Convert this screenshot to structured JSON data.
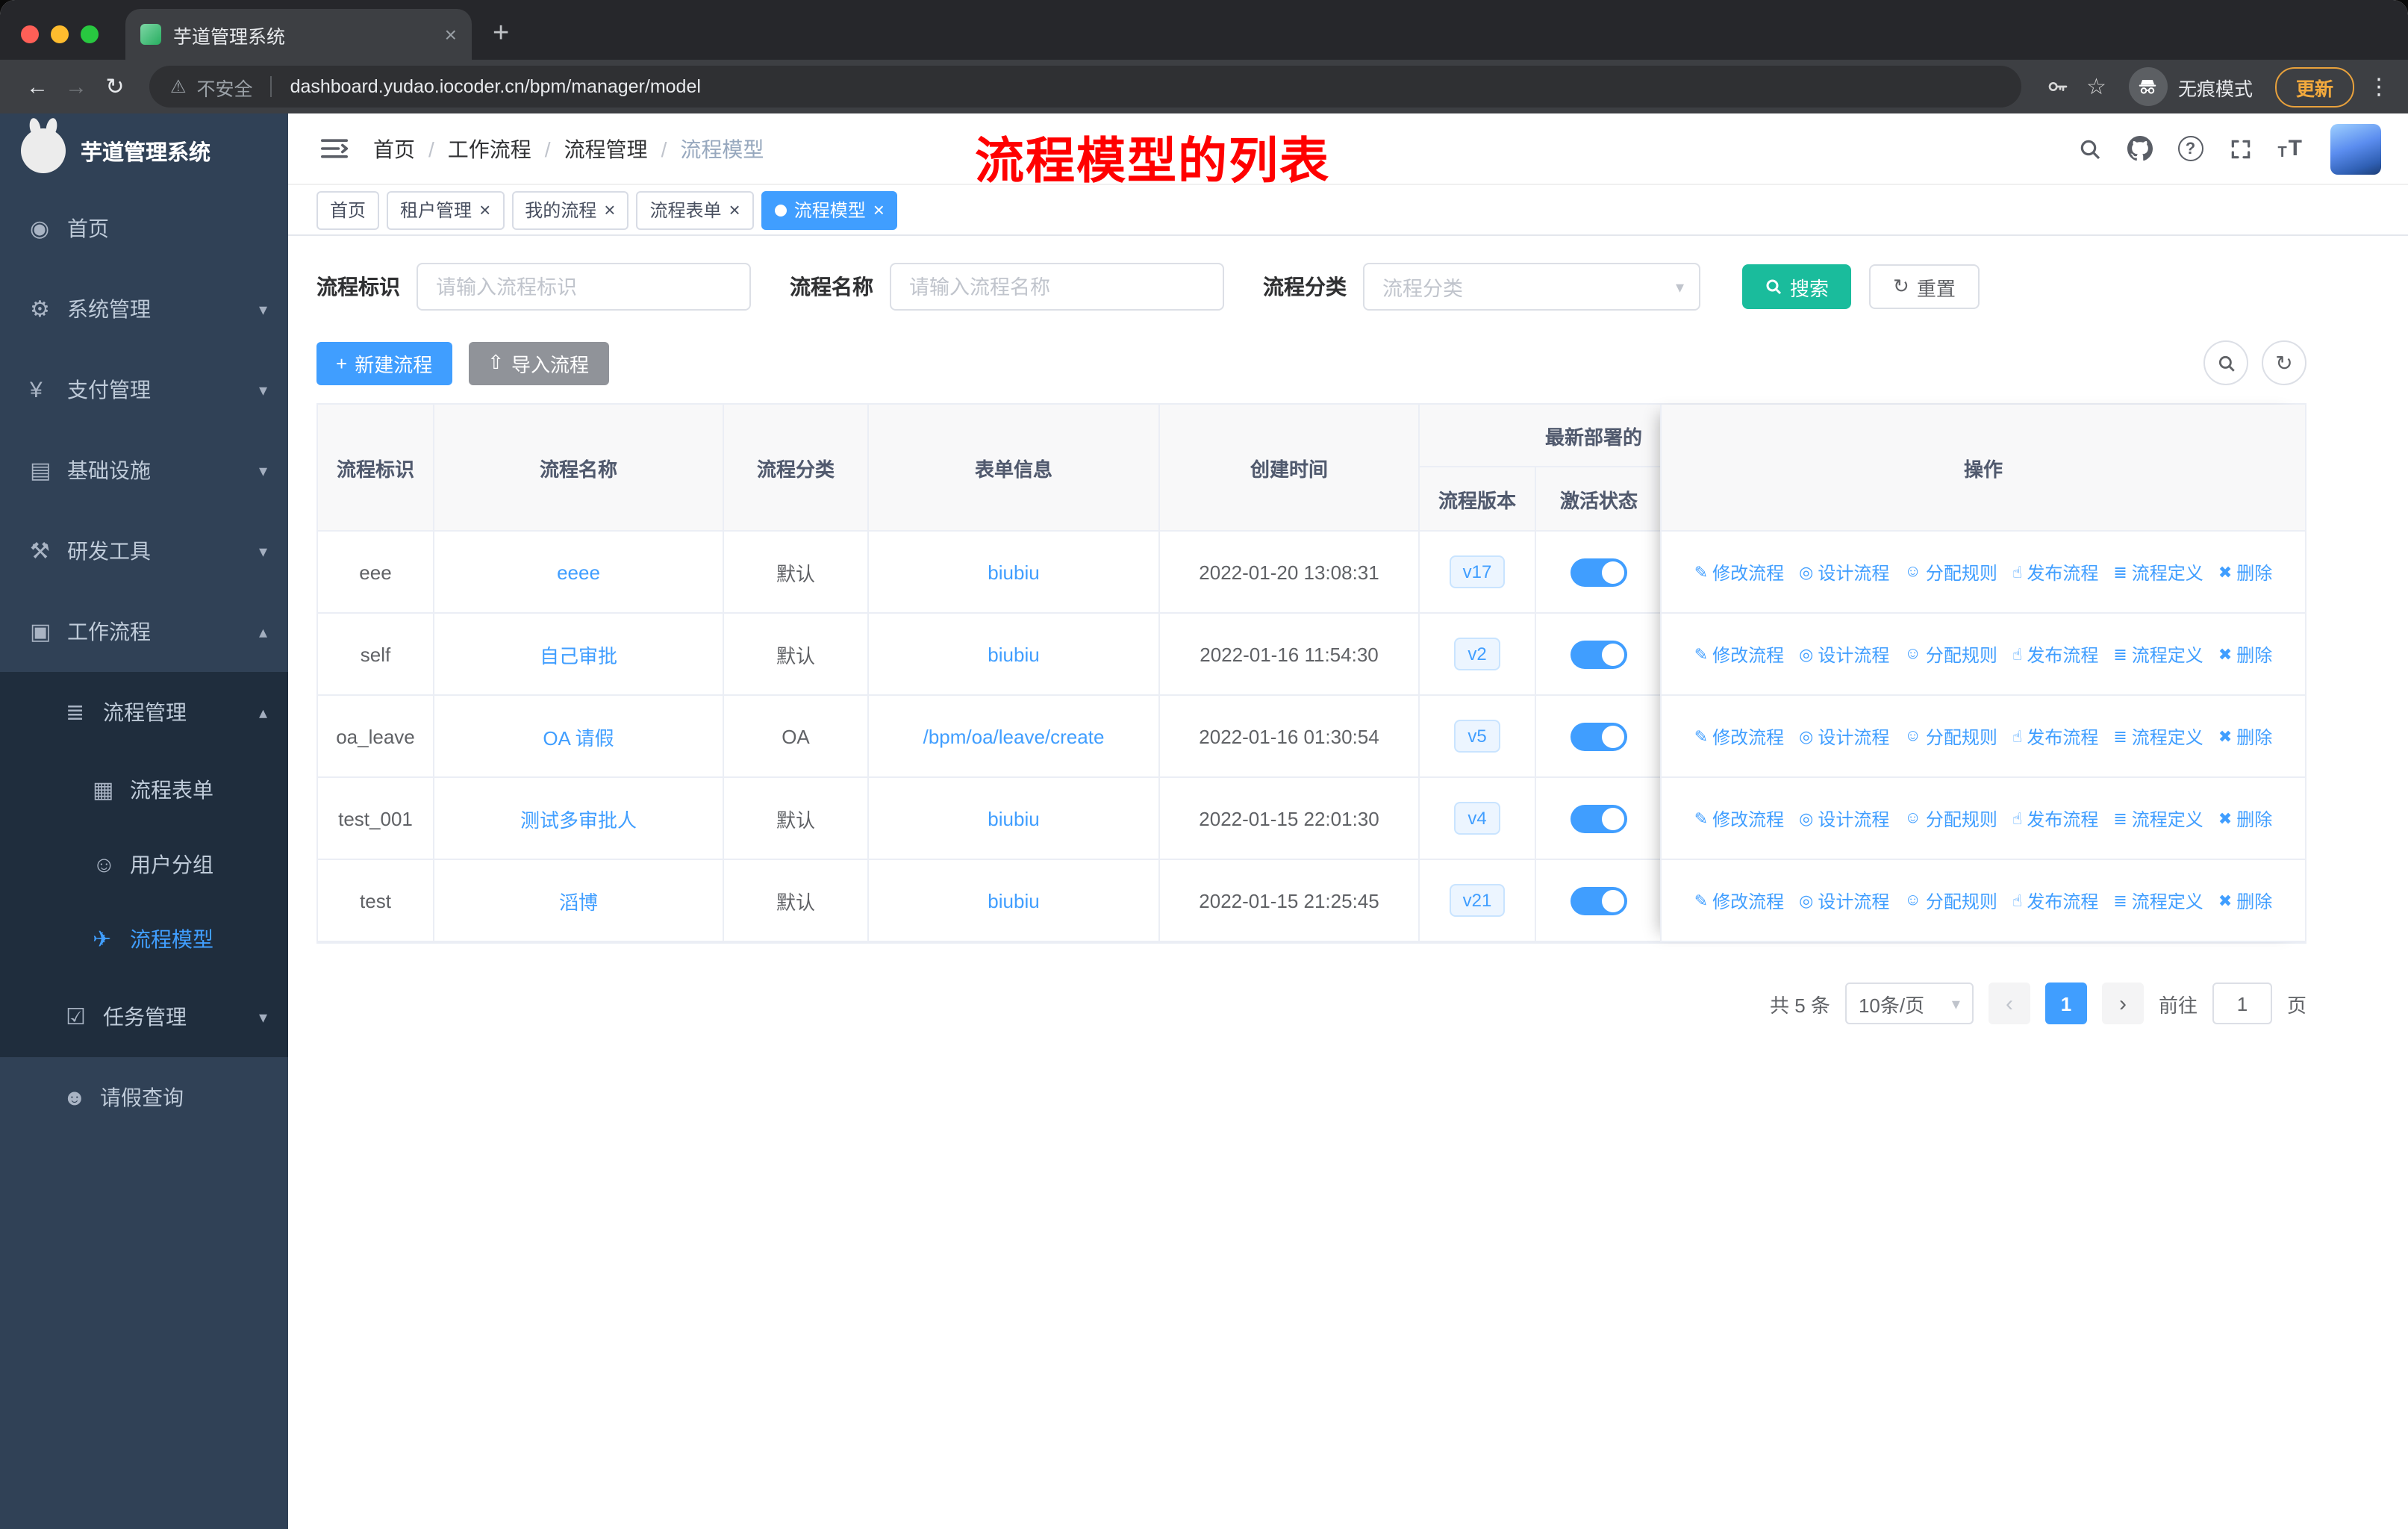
{
  "theme": {
    "accent": "#409eff",
    "teal": "#1abc9c",
    "sidebar": "#304156",
    "sidebar_sub": "#1f2d3d",
    "toggle": "#409eff",
    "red": "#ff0000"
  },
  "icons": {
    "close": "×",
    "add_tab": "+",
    "kebab": "⋮",
    "back": "←",
    "forward": "→",
    "reload": "↻",
    "warning": "⚠",
    "star": "☆",
    "chevron_down": "▾",
    "chevron_up": "▴",
    "select_arrow": "▾",
    "help": "?",
    "font_size": "T",
    "refresh": "↻",
    "plus": "+",
    "upload": "⇧",
    "prev": "‹",
    "next": "›"
  },
  "browser": {
    "tab_title": "芋道管理系统",
    "security_label": "不安全",
    "url": "dashboard.yudao.iocoder.cn/bpm/manager/model",
    "incognito_label": "无痕模式",
    "update_label": "更新"
  },
  "sidebar": {
    "title": "芋道管理系统",
    "items": [
      {
        "label": "首页",
        "glyph": "◉"
      },
      {
        "label": "系统管理",
        "glyph": "⚙"
      },
      {
        "label": "支付管理",
        "glyph": "¥"
      },
      {
        "label": "基础设施",
        "glyph": "▤"
      },
      {
        "label": "研发工具",
        "glyph": "⚒"
      },
      {
        "label": "工作流程",
        "glyph": "▣"
      },
      {
        "label": "流程管理",
        "glyph": "≣"
      },
      {
        "label": "流程表单",
        "glyph": "▦"
      },
      {
        "label": "用户分组",
        "glyph": "☺"
      },
      {
        "label": "流程模型",
        "glyph": "✈"
      },
      {
        "label": "任务管理",
        "glyph": "☑"
      },
      {
        "label": "请假查询",
        "glyph": "☻"
      }
    ]
  },
  "navbar": {
    "breadcrumb": [
      "首页",
      "工作流程",
      "流程管理",
      "流程模型"
    ],
    "separator": "/",
    "annotation": "流程模型的列表"
  },
  "tags": {
    "home": "首页",
    "tenant": "租户管理",
    "my_process": "我的流程",
    "process_form": "流程表单",
    "process_model": "流程模型"
  },
  "filter": {
    "id_label": "流程标识",
    "id_placeholder": "请输入流程标识",
    "name_label": "流程名称",
    "name_placeholder": "请输入流程名称",
    "category_label": "流程分类",
    "category_placeholder": "流程分类",
    "search": "搜索",
    "reset": "重置"
  },
  "actions_bar": {
    "create": "新建流程",
    "import": "导入流程"
  },
  "table": {
    "columns": {
      "id": "流程标识",
      "name": "流程名称",
      "category": "流程分类",
      "form": "表单信息",
      "created": "创建时间",
      "group": "最新部署的",
      "version": "流程版本",
      "status": "激活状态",
      "op": "操作"
    },
    "rows": [
      {
        "id": "eee",
        "name": "eeee",
        "category": "默认",
        "form": "biubiu",
        "created": "2022-01-20 13:08:31",
        "version": "v17"
      },
      {
        "id": "self",
        "name": "自己审批",
        "category": "默认",
        "form": "biubiu",
        "created": "2022-01-16 11:54:30",
        "version": "v2"
      },
      {
        "id": "oa_leave",
        "name": "OA 请假",
        "category": "OA",
        "form": "/bpm/oa/leave/create",
        "created": "2022-01-16 01:30:54",
        "version": "v5"
      },
      {
        "id": "test_001",
        "name": "测试多审批人",
        "category": "默认",
        "form": "biubiu",
        "created": "2022-01-15 22:01:30",
        "version": "v4"
      },
      {
        "id": "test",
        "name": "滔博",
        "category": "默认",
        "form": "biubiu",
        "created": "2022-01-15 21:25:45",
        "version": "v21"
      }
    ],
    "row_actions": [
      {
        "glyph": "✎",
        "label": "修改流程"
      },
      {
        "glyph": "◎",
        "label": "设计流程"
      },
      {
        "glyph": "☺",
        "label": "分配规则"
      },
      {
        "glyph": "☝",
        "label": "发布流程"
      },
      {
        "glyph": "≣",
        "label": "流程定义"
      },
      {
        "glyph": "✖",
        "label": "删除"
      }
    ]
  },
  "pagination": {
    "total": "共 5 条",
    "page_size": "10条/页",
    "current": "1",
    "goto_label": "前往",
    "goto_value": "1",
    "unit": "页"
  }
}
